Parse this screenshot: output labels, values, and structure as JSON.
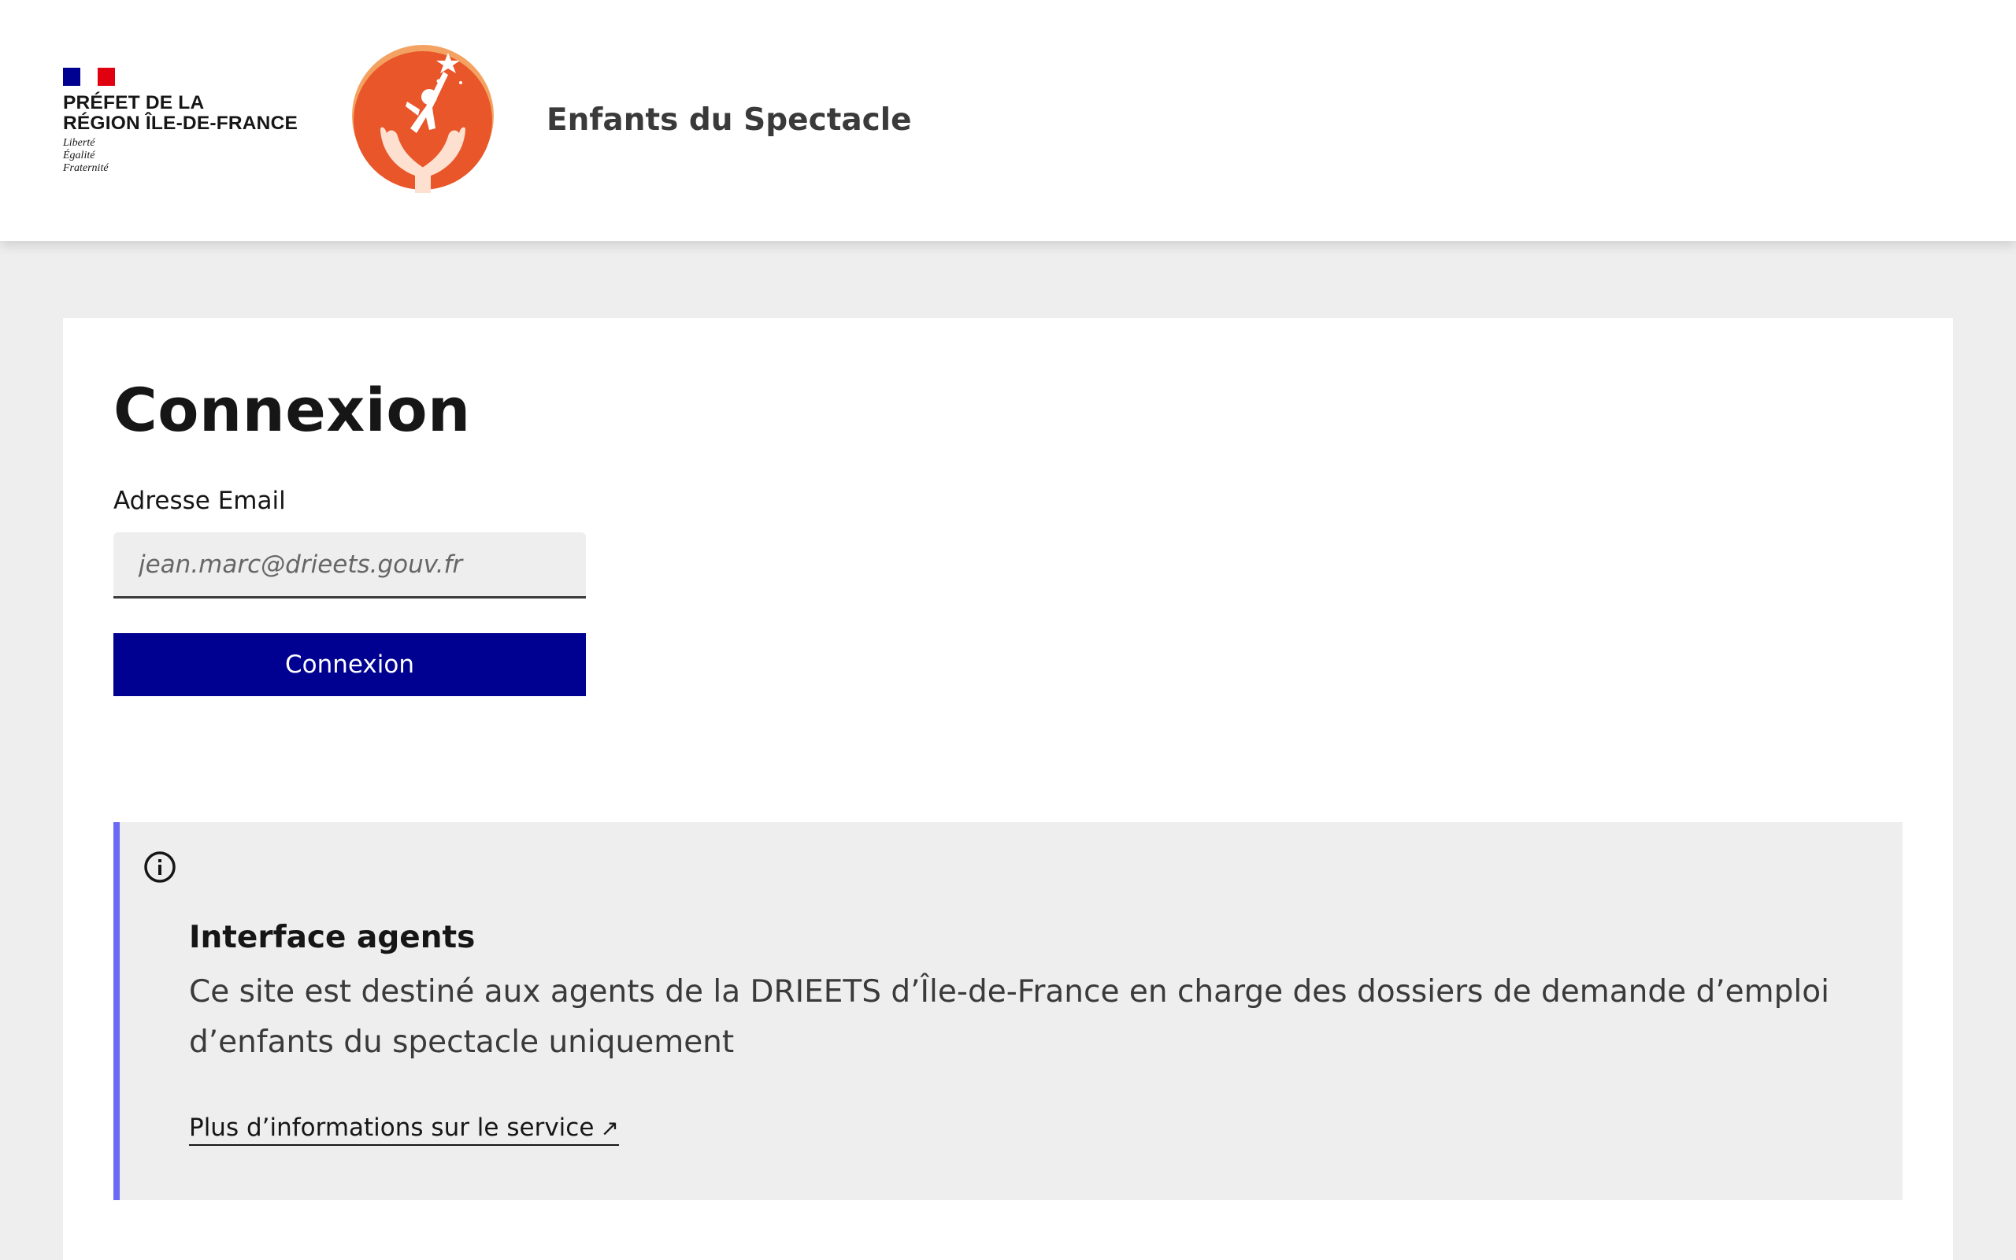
{
  "header": {
    "prefet_line1": "PRÉFET DE LA",
    "prefet_line2": "RÉGION ÎLE-DE-FRANCE",
    "devise": [
      "Liberté",
      "Égalité",
      "Fraternité"
    ],
    "site_name": "Enfants du Spectacle",
    "flag_colors": [
      "#000091",
      "#ffffff",
      "#e1000f"
    ],
    "logo_icon": "child-reaching-star-logo-icon"
  },
  "login": {
    "title": "Connexion",
    "email_label": "Adresse Email",
    "email_placeholder": "jean.marc@drieets.gouv.fr",
    "email_value": "",
    "submit_label": "Connexion",
    "button_color": "#000091"
  },
  "notice": {
    "icon": "info-icon",
    "title": "Interface agents",
    "text": "Ce site est destiné aux agents de la DRIEETS d’Île-de-France en charge des dossiers de demande d’emploi d’enfants du spectacle uniquement",
    "link_label": "Plus d’informations sur le service",
    "link_icon": "↗",
    "accent_color": "#6a6af4"
  }
}
